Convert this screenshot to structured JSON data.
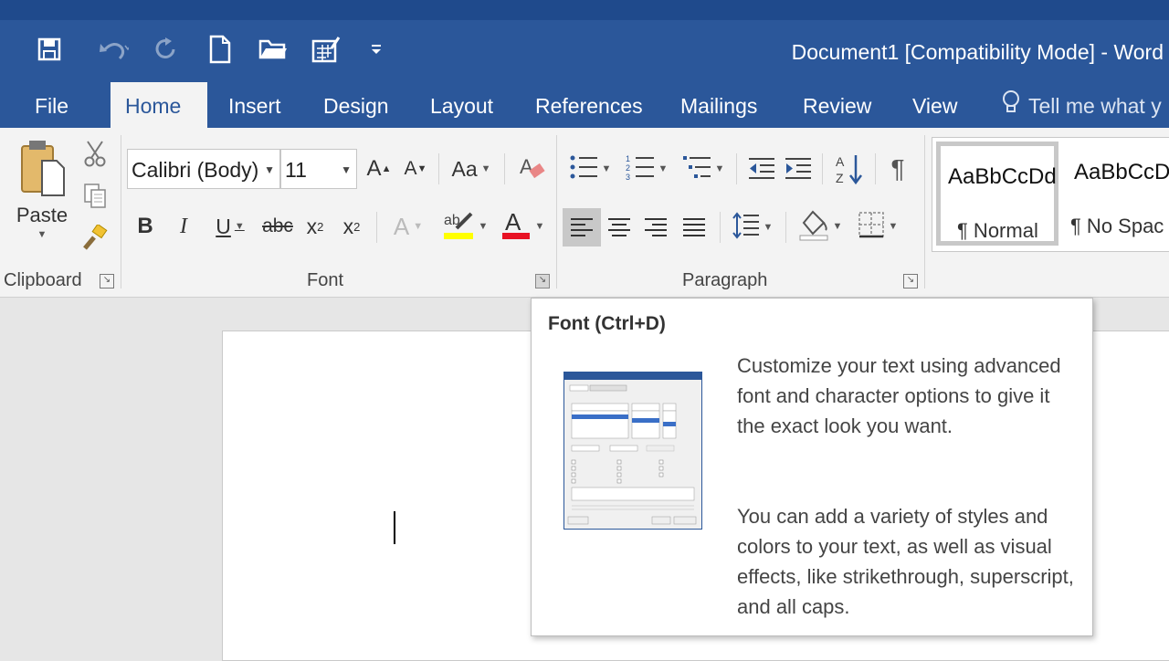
{
  "window": {
    "title": "Document1 [Compatibility Mode] - Word"
  },
  "quick_access": {
    "save_icon": "save-icon",
    "undo_icon": "undo-icon",
    "redo_icon": "redo-icon",
    "new_icon": "new-document-icon",
    "open_icon": "open-folder-icon",
    "touch_mode_icon": "touch-mode-icon",
    "customize_icon": "customize-qat-icon"
  },
  "tabs": [
    {
      "label": "File"
    },
    {
      "label": "Home"
    },
    {
      "label": "Insert"
    },
    {
      "label": "Design"
    },
    {
      "label": "Layout"
    },
    {
      "label": "References"
    },
    {
      "label": "Mailings"
    },
    {
      "label": "Review"
    },
    {
      "label": "View"
    }
  ],
  "tell_me": {
    "text": "Tell me what y"
  },
  "ribbon": {
    "clipboard": {
      "label": "Clipboard",
      "paste_label": "Paste"
    },
    "font": {
      "label": "Font",
      "font_name": "Calibri (Body)",
      "font_size": "11",
      "change_case": "Aa",
      "strike_sample": "abc"
    },
    "paragraph": {
      "label": "Paragraph"
    },
    "styles": [
      {
        "sample": "AaBbCcDd",
        "name": "¶ Normal"
      },
      {
        "sample": "AaBbCcD",
        "name": "¶ No Spac"
      }
    ]
  },
  "tooltip": {
    "title": "Font (Ctrl+D)",
    "paragraph1": "Customize your text using advanced font and character options to give it the exact look you want.",
    "paragraph2": "You can add a variety of styles and colors to your text, as well as visual effects, like strikethrough, superscript, and all caps."
  },
  "colors": {
    "title_bar": "#2b579a",
    "highlight": "#ffff00",
    "font_color": "#e81123"
  }
}
